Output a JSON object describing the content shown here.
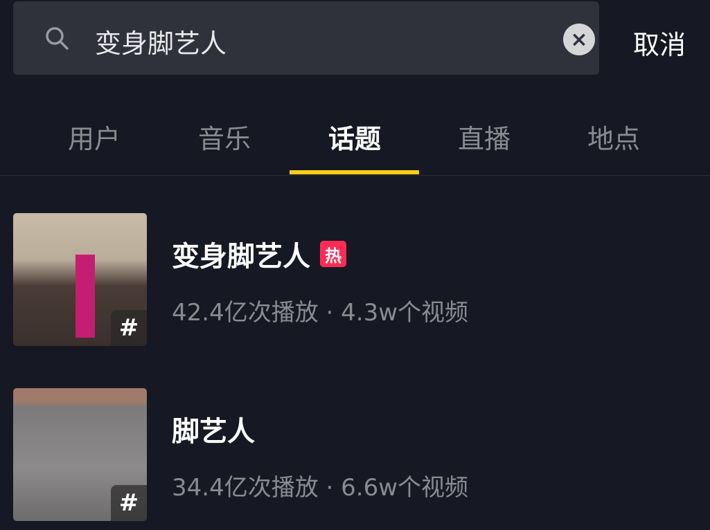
{
  "search": {
    "query": "变身脚艺人",
    "cancel_label": "取消"
  },
  "tabs": [
    {
      "label": "用户"
    },
    {
      "label": "音乐"
    },
    {
      "label": "话题",
      "active": true
    },
    {
      "label": "直播"
    },
    {
      "label": "地点"
    }
  ],
  "colors": {
    "accent": "#face15",
    "hot": "#fe2c55",
    "background": "#161823"
  },
  "results": [
    {
      "title": "变身脚艺人",
      "badge": "热",
      "meta": "42.4亿次播放 · 4.3w个视频",
      "hash": "#"
    },
    {
      "title": "脚艺人",
      "meta": "34.4亿次播放 · 6.6w个视频",
      "hash": "#"
    }
  ]
}
